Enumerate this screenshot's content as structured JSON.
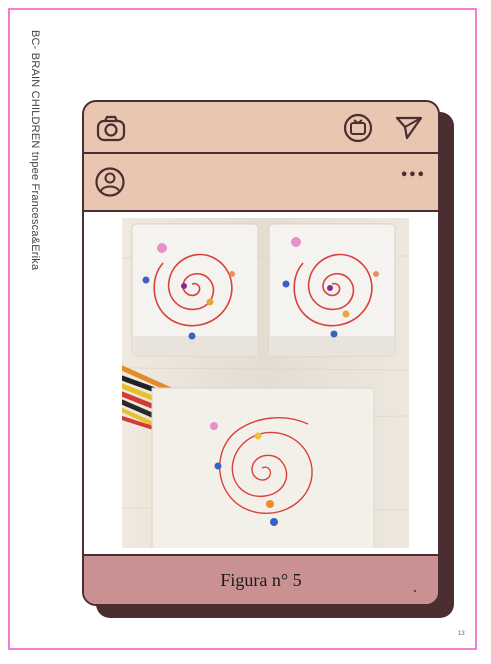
{
  "page": {
    "side_text": "BC- BRAIN CHILDREN tnpee Francesca&Erika",
    "page_number": "13"
  },
  "post": {
    "menu_glyph": "•••",
    "caption": "Figura n° 5"
  },
  "icons": {
    "camera": "camera-icon",
    "tv": "tv-icon",
    "send": "send-icon",
    "profile": "profile-icon",
    "more": "more-icon"
  },
  "colors": {
    "border_pink": "#f27fd2",
    "frame_dark": "#4a2e31",
    "frame_beige": "#e9c6b1",
    "caption_band": "#c99192",
    "spiral_red": "#d8423b"
  }
}
